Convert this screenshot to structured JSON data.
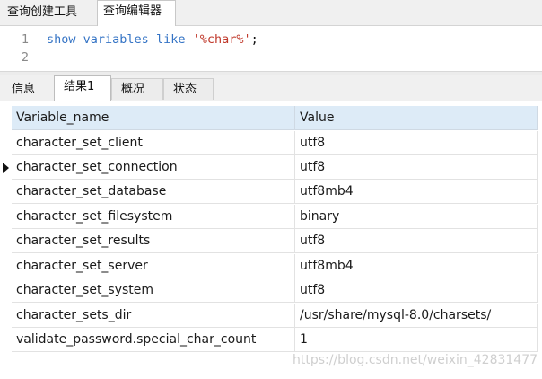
{
  "top_tabs": {
    "query_builder": "查询创建工具",
    "query_editor": "查询编辑器"
  },
  "editor": {
    "line1_no": "1",
    "line2_no": "2",
    "kw_show": "show",
    "kw_variables": "variables",
    "kw_like": "like",
    "string": "'%char%'",
    "semicolon": ";"
  },
  "result_tabs": {
    "info": "信息",
    "result1": "结果1",
    "overview": "概况",
    "status": "状态"
  },
  "table": {
    "headers": {
      "name": "Variable_name",
      "value": "Value"
    },
    "rows": [
      {
        "name": "character_set_client",
        "value": "utf8"
      },
      {
        "name": "character_set_connection",
        "value": "utf8"
      },
      {
        "name": "character_set_database",
        "value": "utf8mb4"
      },
      {
        "name": "character_set_filesystem",
        "value": "binary"
      },
      {
        "name": "character_set_results",
        "value": "utf8"
      },
      {
        "name": "character_set_server",
        "value": "utf8mb4"
      },
      {
        "name": "character_set_system",
        "value": "utf8"
      },
      {
        "name": "character_sets_dir",
        "value": "/usr/share/mysql-8.0/charsets/"
      },
      {
        "name": "validate_password.special_char_count",
        "value": "1"
      }
    ]
  },
  "watermark": "https://blog.csdn.net/weixin_42831477",
  "colors": {
    "keyword": "#3574c5",
    "string": "#c0392b",
    "header_bg": "#ddebf7"
  }
}
